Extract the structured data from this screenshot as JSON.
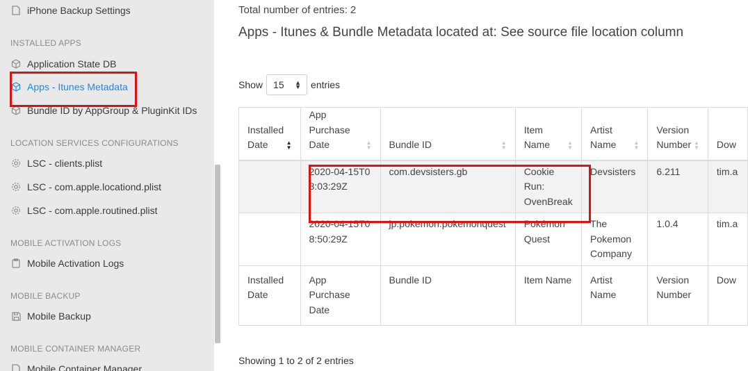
{
  "sidebar": {
    "top_item": "iPhone Backup Settings",
    "sections": [
      {
        "heading": "INSTALLED APPS",
        "items": [
          "Application State DB",
          "Apps - Itunes Metadata",
          "Bundle ID by AppGroup & PluginKit IDs"
        ]
      },
      {
        "heading": "LOCATION SERVICES CONFIGURATIONS",
        "items": [
          "LSC - clients.plist",
          "LSC - com.apple.locationd.plist",
          "LSC - com.apple.routined.plist"
        ]
      },
      {
        "heading": "MOBILE ACTIVATION LOGS",
        "items": [
          "Mobile Activation Logs"
        ]
      },
      {
        "heading": "MOBILE BACKUP",
        "items": [
          "Mobile Backup"
        ]
      },
      {
        "heading": "MOBILE CONTAINER MANAGER",
        "items": [
          "Mobile Container Manager"
        ]
      }
    ],
    "active_item": "Apps - Itunes Metadata"
  },
  "main": {
    "total_entries": "Total number of entries: 2",
    "title": "Apps - Itunes & Bundle Metadata located at: See source file location column",
    "show_label": "Show",
    "page_size": "15",
    "entries_label": "entries",
    "footer_info": "Showing 1 to 2 of 2 entries"
  },
  "table": {
    "headers": [
      "Installed Date",
      "App Purchase Date",
      "Bundle ID",
      "Item Name",
      "Artist Name",
      "Version Number",
      "Dow"
    ],
    "rows": [
      [
        "",
        "2020-04-15T08:03:29Z",
        "com.devsisters.gb",
        "Cookie Run: OvenBreak",
        "Devsisters",
        "6.211",
        "tim.a"
      ],
      [
        "",
        "2020-04-15T08:50:29Z",
        "jp.pokemon.pokemonquest",
        "Pokémon Quest",
        "The Pokemon Company",
        "1.0.4",
        "tim.a"
      ]
    ],
    "footer": [
      "Installed Date",
      "App Purchase Date",
      "Bundle ID",
      "Item Name",
      "Artist Name",
      "Version Number",
      "Dow"
    ]
  },
  "colors": {
    "sidebar_bg": "#e9e9e9",
    "active_link": "#1e88e5",
    "highlight_box": "#e01010",
    "selected_row": "#f2f2f2"
  }
}
